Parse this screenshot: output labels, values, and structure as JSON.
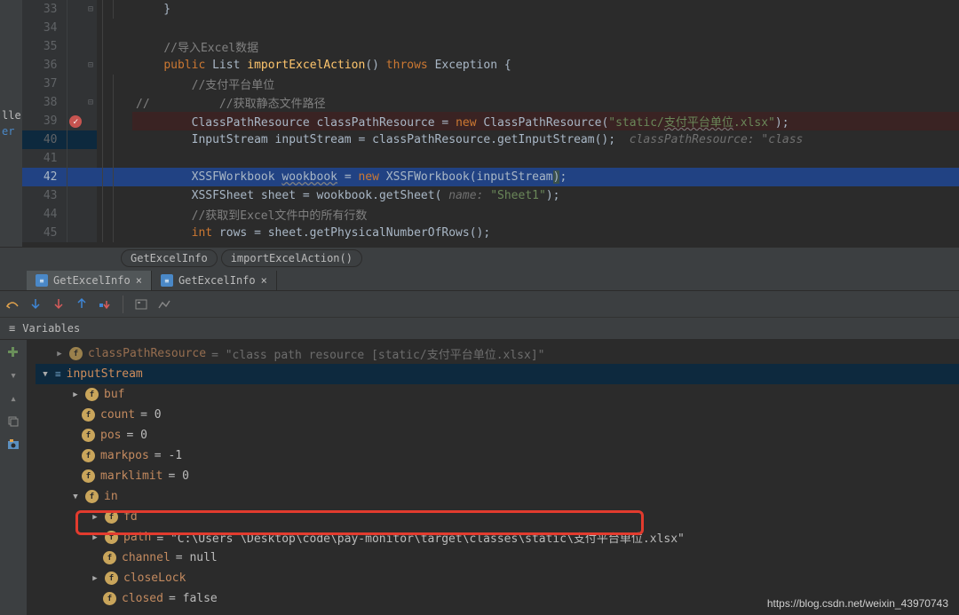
{
  "editor": {
    "lines": [
      {
        "num": 33,
        "code": "}"
      },
      {
        "num": 34,
        "code": ""
      },
      {
        "num": 35,
        "code": "//导入Excel数据"
      },
      {
        "num": 36,
        "code": "public List importExcelAction() throws Exception {"
      },
      {
        "num": 37,
        "code": "    //支付平台单位"
      },
      {
        "num": 38,
        "code": "//          //获取静态文件路径"
      },
      {
        "num": 39,
        "code": "    ClassPathResource classPathResource = new ClassPathResource(\"static/支付平台单位.xlsx\");"
      },
      {
        "num": 40,
        "code": "    InputStream inputStream = classPathResource.getInputStream();  classPathResource: \"class"
      },
      {
        "num": 41,
        "code": ""
      },
      {
        "num": 42,
        "code": "    XSSFWorkbook wookbook = new XSSFWorkbook(inputStream);"
      },
      {
        "num": 43,
        "code": "    XSSFSheet sheet = wookbook.getSheet( name: \"Sheet1\");"
      },
      {
        "num": 44,
        "code": "    //获取到Excel文件中的所有行数"
      },
      {
        "num": 45,
        "code": "    int rows = sheet.getPhysicalNumberOfRows();"
      }
    ],
    "breadcrumbs": [
      "GetExcelInfo",
      "importExcelAction()"
    ],
    "left_labels": [
      "ller",
      "er"
    ]
  },
  "tabs": [
    {
      "label": "GetExcelInfo",
      "active": true
    },
    {
      "label": "GetExcelInfo",
      "active": false
    }
  ],
  "variables_header": "Variables",
  "tree": {
    "top_truncated": "classPathResource = \"class path resource [static/支付平台单位.xlsx]\"",
    "root": "inputStream",
    "buf": "buf",
    "count_name": "count",
    "count_val": " = 0",
    "pos_name": "pos",
    "pos_val": " = 0",
    "markpos_name": "markpos",
    "markpos_val": " = -1",
    "marklimit_name": "marklimit",
    "marklimit_val": " = 0",
    "in_name": "in",
    "fd_name": "fd",
    "path_name": "path",
    "path_val": " = \"C:\\Users           \\Desktop\\code\\pay-monitor\\target\\classes\\static\\支付平台单位.xlsx\"",
    "channel_name": "channel",
    "channel_val": " = null",
    "closeLock_name": "closeLock",
    "closed_name": "closed",
    "closed_val": " = false"
  },
  "watermark": "https://blog.csdn.net/weixin_43970743"
}
